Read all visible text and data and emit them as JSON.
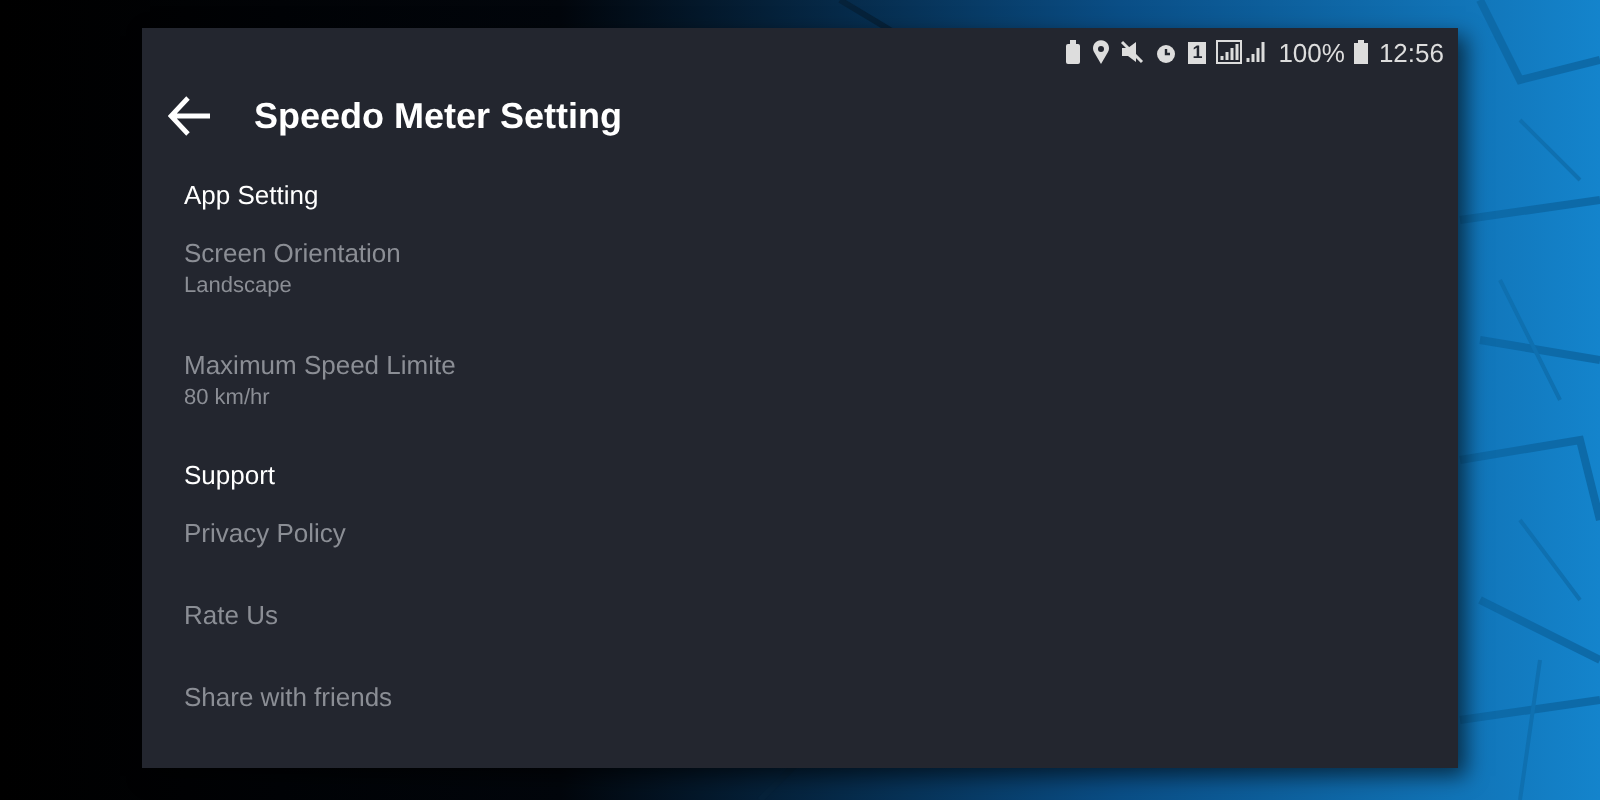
{
  "status_bar": {
    "sim": "1",
    "battery": "100%",
    "time": "12:56"
  },
  "header": {
    "title": "Speedo Meter Setting"
  },
  "sections": [
    {
      "title": "App Setting",
      "items": [
        {
          "title": "Screen Orientation",
          "subtitle": "Landscape"
        },
        {
          "title": "Maximum Speed Limite",
          "subtitle": "80 km/hr"
        }
      ]
    },
    {
      "title": "Support",
      "items": [
        {
          "title": "Privacy Policy"
        },
        {
          "title": "Rate Us"
        },
        {
          "title": "Share with friends"
        }
      ]
    }
  ]
}
